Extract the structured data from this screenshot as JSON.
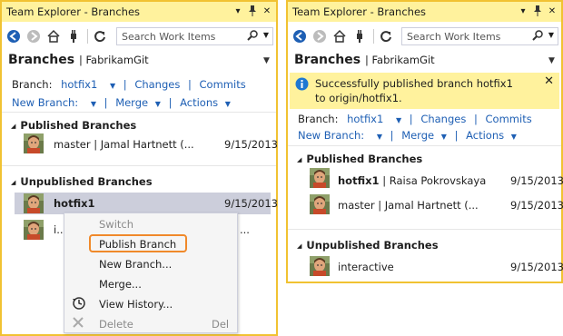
{
  "colors": {
    "title_bar": "#fff29d",
    "border": "#f1c232",
    "link": "#1e5fb4",
    "selection": "#cccedb",
    "highlight": "#f0892a",
    "info_bar": "#fff29d"
  },
  "left": {
    "title": "Team Explorer - Branches",
    "search_placeholder": "Search Work Items",
    "header": "Branches",
    "repo": "FabrikamGit",
    "branch_label": "Branch:",
    "current_branch": "hotfix1",
    "changes": "Changes",
    "commits": "Commits",
    "new_branch": "New Branch:",
    "merge": "Merge",
    "actions": "Actions",
    "published_title": "Published Branches",
    "published": [
      {
        "name": "master",
        "detail": "Jamal Hartnett (...",
        "date": "9/15/2013"
      }
    ],
    "unpublished_title": "Unpublished Branches",
    "unpublished": [
      {
        "name": "hotfix1",
        "date": "9/15/2013"
      },
      {
        "name": "i...",
        "tail": "..."
      }
    ],
    "context_menu": {
      "switch": "Switch",
      "publish": "Publish Branch",
      "new_branch": "New Branch...",
      "merge": "Merge...",
      "view_history": "View History...",
      "delete": "Delete",
      "delete_shortcut": "Del"
    }
  },
  "right": {
    "title": "Team Explorer - Branches",
    "search_placeholder": "Search Work Items",
    "header": "Branches",
    "repo": "FabrikamGit",
    "info_message": "Successfully published branch hotfix1 to origin/hotfix1.",
    "branch_label": "Branch:",
    "current_branch": "hotfix1",
    "changes": "Changes",
    "commits": "Commits",
    "new_branch": "New Branch:",
    "merge": "Merge",
    "actions": "Actions",
    "published_title": "Published Branches",
    "published": [
      {
        "name": "hotfix1",
        "detail": "Raisa Pokrovskaya",
        "date": "9/15/2013"
      },
      {
        "name": "master",
        "detail": "Jamal Hartnett (...",
        "date": "9/15/2013"
      }
    ],
    "unpublished_title": "Unpublished Branches",
    "unpublished": [
      {
        "name": "interactive",
        "date": "9/15/2013"
      }
    ]
  }
}
